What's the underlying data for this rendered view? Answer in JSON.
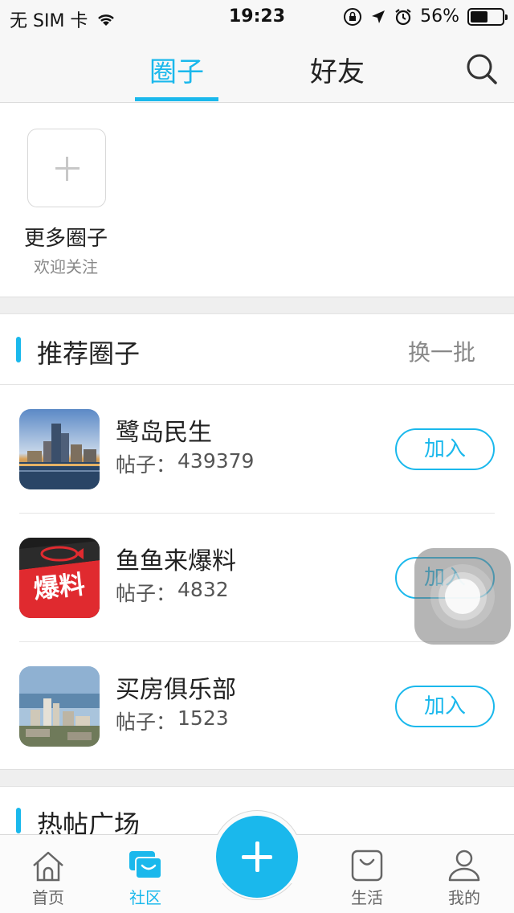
{
  "status_bar": {
    "carrier": "无 SIM 卡",
    "time": "19:23",
    "battery": "56%",
    "battery_level": 0.56,
    "icons": [
      "wifi-icon",
      "rotation-lock-icon",
      "location-icon",
      "alarm-icon",
      "battery-icon"
    ]
  },
  "header": {
    "tabs": [
      {
        "label": "圈子",
        "active": true
      },
      {
        "label": "好友",
        "active": false
      }
    ],
    "search_icon": "search-icon"
  },
  "more": {
    "title": "更多圈子",
    "subtitle": "欢迎关注"
  },
  "recommend": {
    "title": "推荐圈子",
    "refresh_label": "换一批",
    "posts_prefix": "帖子：",
    "join_label": "加入",
    "items": [
      {
        "name": "鹭岛民生",
        "posts": "439379"
      },
      {
        "name": "鱼鱼来爆料",
        "posts": "4832",
        "logo_text": "爆料"
      },
      {
        "name": "买房俱乐部",
        "posts": "1523"
      }
    ]
  },
  "hot": {
    "title": "热帖广场"
  },
  "tab_bar": {
    "items": [
      {
        "label": "首页",
        "icon": "home-icon"
      },
      {
        "label": "社区",
        "icon": "community-icon",
        "active": true
      },
      {
        "label": "生活",
        "icon": "life-bag-icon"
      },
      {
        "label": "我的",
        "icon": "person-icon"
      }
    ],
    "fab_icon": "plus-icon"
  },
  "colors": {
    "accent": "#1ab8ec",
    "badge_red": "#e02a2f"
  }
}
